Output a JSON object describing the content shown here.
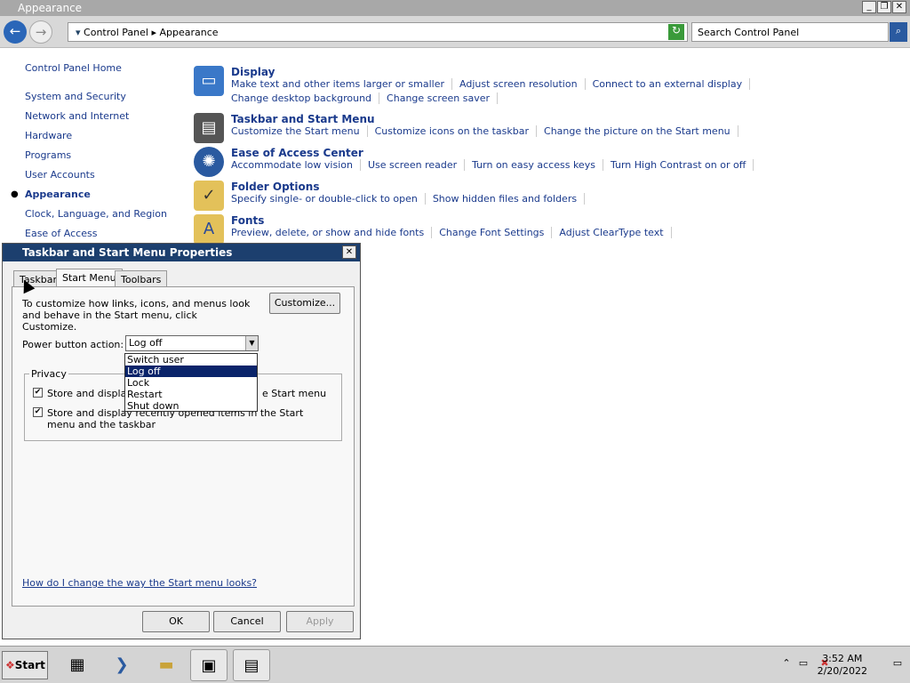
{
  "window": {
    "title": "Appearance"
  },
  "address": {
    "path": [
      "Control Panel",
      "Appearance"
    ],
    "search_placeholder": "Search Control Panel"
  },
  "sidebar": {
    "home": "Control Panel Home",
    "items": [
      {
        "label": "System and Security"
      },
      {
        "label": "Network and Internet"
      },
      {
        "label": "Hardware"
      },
      {
        "label": "Programs"
      },
      {
        "label": "User Accounts"
      },
      {
        "label": "Appearance",
        "current": true
      },
      {
        "label": "Clock, Language, and Region"
      },
      {
        "label": "Ease of Access"
      }
    ]
  },
  "categories": [
    {
      "title": "Display",
      "icon": "monitor-icon",
      "links": [
        [
          "Make text and other items larger or smaller",
          "Adjust screen resolution",
          "Connect to an external display"
        ],
        [
          "Change desktop background",
          "Change screen saver"
        ]
      ]
    },
    {
      "title": "Taskbar and Start Menu",
      "icon": "taskbar-icon",
      "links": [
        [
          "Customize the Start menu",
          "Customize icons on the taskbar",
          "Change the picture on the Start menu"
        ]
      ]
    },
    {
      "title": "Ease of Access Center",
      "icon": "ease-of-access-icon",
      "links": [
        [
          "Accommodate low vision",
          "Use screen reader",
          "Turn on easy access keys",
          "Turn High Contrast on or off"
        ]
      ]
    },
    {
      "title": "Folder Options",
      "icon": "folder-options-icon",
      "links": [
        [
          "Specify single- or double-click to open",
          "Show hidden files and folders"
        ]
      ]
    },
    {
      "title": "Fonts",
      "icon": "fonts-icon",
      "links": [
        [
          "Preview, delete, or show and hide fonts",
          "Change Font Settings",
          "Adjust ClearType text"
        ]
      ]
    }
  ],
  "dialog": {
    "title": "Taskbar and Start Menu Properties",
    "tabs": [
      "Taskbar",
      "Start Menu",
      "Toolbars"
    ],
    "intro": "To customize how links, icons, and menus look and behave in the Start menu, click Customize.",
    "customize": "Customize...",
    "power_label": "Power button action:",
    "power_value": "Log off",
    "power_options": [
      {
        "label": "Switch user"
      },
      {
        "label": "Log off",
        "selected": true
      },
      {
        "label": "Lock"
      },
      {
        "label": "Restart"
      },
      {
        "label": "Shut down"
      }
    ],
    "privacy_label": "Privacy",
    "privacy1_a": "Store and display",
    "privacy1_b": "e Start menu",
    "privacy2": "Store and display recently opened items in the Start menu and the taskbar",
    "help_link": "How do I change the way the Start menu looks?",
    "ok": "OK",
    "cancel": "Cancel",
    "apply": "Apply"
  },
  "taskbar": {
    "start": "Start",
    "time": "3:52 AM",
    "date": "2/20/2022"
  }
}
